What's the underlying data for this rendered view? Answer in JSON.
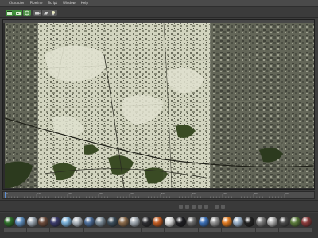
{
  "menu": {
    "items": [
      "Character",
      "Pipeline",
      "Script",
      "Window",
      "Help"
    ]
  },
  "toolbar": {
    "buttons": [
      {
        "name": "render-view-button",
        "icon": "clapper-icon",
        "color": "#3f8f3a"
      },
      {
        "name": "render-picture-viewer-button",
        "icon": "clapper-play-icon",
        "color": "#3f8f3a"
      },
      {
        "name": "render-settings-button",
        "icon": "gear-clapper-icon",
        "color": "#4c8f45"
      },
      {
        "name": "camera-button",
        "icon": "camera-icon",
        "color": "#5a5a5a"
      },
      {
        "name": "floor-button",
        "icon": "floor-icon",
        "color": "#5a5a5a"
      },
      {
        "name": "light-button",
        "icon": "light-bulb-icon",
        "color": "#5a5a5a"
      }
    ]
  },
  "viewport": {
    "render_region_color": "#cfd1ba",
    "outer_color": "#6d6f60",
    "dark_fill": "#2c3a1e"
  },
  "timeline": {
    "tick_labels": [
      "0",
      "10",
      "20",
      "30",
      "40",
      "50",
      "60",
      "70",
      "80",
      "90"
    ],
    "current_frame_color": "#5c8fd6"
  },
  "materials": {
    "swatches": [
      "#2e6e2a",
      "#5f8fbf",
      "#9aa5b0",
      "#6b4a3a",
      "#3a3a6a",
      "#7ab0d8",
      "#b0b8c0",
      "#4d6e9a",
      "#7a8a96",
      "#3b4d5a",
      "#8a6a4a",
      "#a0a8b0",
      "#2c2c30",
      "#c05a20",
      "#d8d8d8",
      "#1e1e22",
      "#6a6a6a",
      "#3b6fb5",
      "#8f8f8f",
      "#e07a20",
      "#9ab0c8",
      "#222222",
      "#7c7c7c",
      "#b0b0b0",
      "#4a4a4a",
      "#5a7a3a",
      "#8a3a3a"
    ]
  }
}
